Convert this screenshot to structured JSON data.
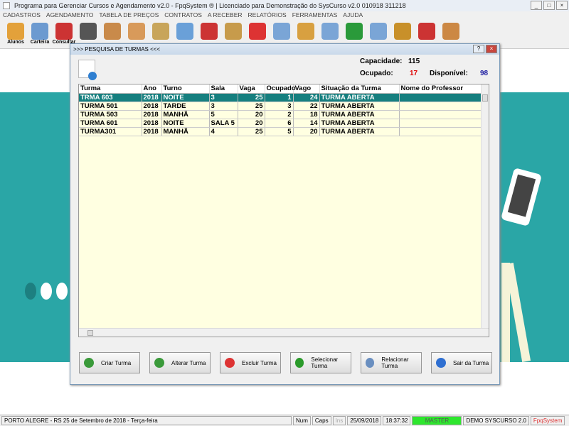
{
  "window": {
    "title": "Programa para Gerenciar Cursos e Agendamento v2.0 - FpqSystem ® | Licenciado para  Demonstração do SysCurso v2.0 010918 311218"
  },
  "menu": [
    "CADASTROS",
    "AGENDAMENTO",
    "TABELA DE PREÇOS",
    "CONTRATOS",
    "A RECEBER",
    "RELATÓRIOS",
    "FERRAMENTAS",
    "AJUDA"
  ],
  "toolbar": [
    {
      "label": "Alunos",
      "color": "#e3a13a"
    },
    {
      "label": "Carteira",
      "color": "#6c9ad0"
    },
    {
      "label": "Consultar",
      "color": "#c33"
    },
    {
      "label": "",
      "color": "#555"
    },
    {
      "label": "",
      "color": "#c98a4a"
    },
    {
      "label": "",
      "color": "#d89a5a"
    },
    {
      "label": "",
      "color": "#c8a55a"
    },
    {
      "label": "",
      "color": "#6aa0d8"
    },
    {
      "label": "",
      "color": "#c33"
    },
    {
      "label": "",
      "color": "#c79b4b"
    },
    {
      "label": "",
      "color": "#d33"
    },
    {
      "label": "",
      "color": "#7aa5d6"
    },
    {
      "label": "",
      "color": "#d8a040"
    },
    {
      "label": "",
      "color": "#7aa5d6"
    },
    {
      "label": "",
      "color": "#2a9a3a"
    },
    {
      "label": "",
      "color": "#7aa5d6"
    },
    {
      "label": "",
      "color": "#c8902a"
    },
    {
      "label": "",
      "color": "#c33"
    },
    {
      "label": "",
      "color": "#c84"
    }
  ],
  "dialog": {
    "title": ">>> PESQUISA DE TURMAS <<<",
    "capacidade_label": "Capacidade:",
    "capacidade": "115",
    "ocupado_label": "Ocupado:",
    "ocupado": "17",
    "disponivel_label": "Disponível:",
    "disponivel": "98",
    "columns": [
      "Turma",
      "Ano",
      "Turno",
      "Sala",
      "Vaga",
      "Ocupado",
      "Vago",
      "Situação da Turma",
      "Nome do Professor"
    ],
    "rows": [
      [
        "TRMA 603",
        "2018",
        "NOITE",
        "3",
        "25",
        "1",
        "24",
        "TURMA ABERTA",
        ""
      ],
      [
        "TURMA 501",
        "2018",
        "TARDE",
        "3",
        "25",
        "3",
        "22",
        "TURMA ABERTA",
        ""
      ],
      [
        "TURMA 503",
        "2018",
        "MANHÃ",
        "5",
        "20",
        "2",
        "18",
        "TURMA ABERTA",
        ""
      ],
      [
        "TURMA 601",
        "2018",
        "NOITE",
        "SALA 5",
        "20",
        "6",
        "14",
        "TURMA ABERTA",
        ""
      ],
      [
        "TURMA301",
        "2018",
        "MANHÃ",
        "4",
        "25",
        "5",
        "20",
        "TURMA ABERTA",
        ""
      ]
    ],
    "buttons": [
      {
        "label": "Criar Turma",
        "color": "#3a9a3a"
      },
      {
        "label": "Alterar Turma",
        "color": "#3a9a3a"
      },
      {
        "label": "Excluir Turma",
        "color": "#d33"
      },
      {
        "label": "Selecionar Turma",
        "color": "#2a9a2a"
      },
      {
        "label": "Relacionar Turma",
        "color": "#6a8fc0"
      },
      {
        "label": "Sair da Turma",
        "color": "#2f6fd1"
      }
    ]
  },
  "statusbar": {
    "location": "PORTO ALEGRE - RS 25 de Setembro de 2018 - Terça-feira",
    "num": "Num",
    "caps": "Caps",
    "ins": "Ins",
    "date": "25/09/2018",
    "time": "18:37:32",
    "user": "MASTER",
    "db": "DEMO SYSCURSO 2.0",
    "brand": "FpqSystem"
  }
}
